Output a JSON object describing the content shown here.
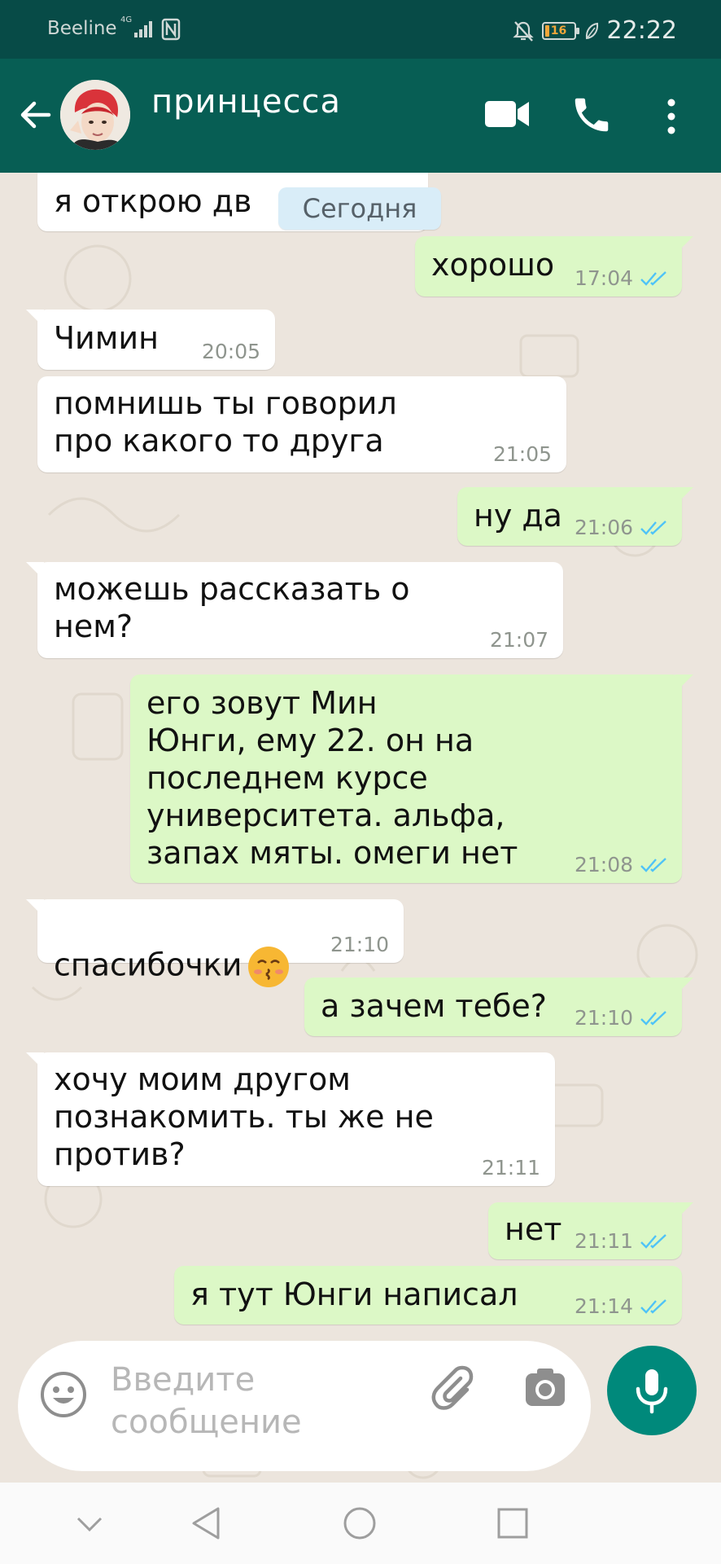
{
  "status_bar": {
    "carrier": "Beeline",
    "network": "4G",
    "battery": "16",
    "battery_fraction": 0.16,
    "time": "22:22"
  },
  "header": {
    "title": "принцесса",
    "avatar_icon": "avatar-photo",
    "actions": [
      "video-call-icon",
      "voice-call-icon",
      "more-options-icon"
    ]
  },
  "chat": {
    "date_separator": "Сегодня",
    "messages": [
      {
        "direction": "in",
        "text": "я открою дв",
        "time": ""
      },
      {
        "direction": "out",
        "text": "хорошо",
        "time": "17:04",
        "read": true
      },
      {
        "direction": "in",
        "text": "Чимин",
        "time": "20:05"
      },
      {
        "direction": "in",
        "text": "помнишь ты говорил\nпро какого то друга",
        "time": "21:05"
      },
      {
        "direction": "out",
        "text": "ну да",
        "time": "21:06",
        "read": true
      },
      {
        "direction": "in",
        "text": "можешь рассказать о\nнем?",
        "time": "21:07"
      },
      {
        "direction": "out",
        "text": "его зовут Мин\nЮнги, ему 22. он на\nпоследнем курсе\nуниверситета. альфа,\nзапах мяты. омеги нет",
        "time": "21:08",
        "read": true
      },
      {
        "direction": "in",
        "text": "спасибочки",
        "emoji": "kissing-face-emoji",
        "time": "21:10"
      },
      {
        "direction": "out",
        "text": "а зачем тебе?",
        "time": "21:10",
        "read": true
      },
      {
        "direction": "in",
        "text": "хочу моим другом\nпознакомить. ты же не\nпротив?",
        "time": "21:11"
      },
      {
        "direction": "out",
        "text": "нет",
        "time": "21:11",
        "read": true
      },
      {
        "direction": "out",
        "text": "я тут Юнги написал",
        "time": "21:14",
        "read": true
      }
    ]
  },
  "composer": {
    "placeholder": "Введите\nсообщение",
    "icons": [
      "emoji-icon",
      "attach-icon",
      "camera-icon",
      "mic-icon"
    ]
  },
  "colors": {
    "header": "#075e54",
    "status_bar": "#074b47",
    "outgoing_bubble": "#dcf8c6",
    "incoming_bubble": "#ffffff",
    "read_ticks": "#4fc3f7",
    "mic_button": "#00897b"
  }
}
